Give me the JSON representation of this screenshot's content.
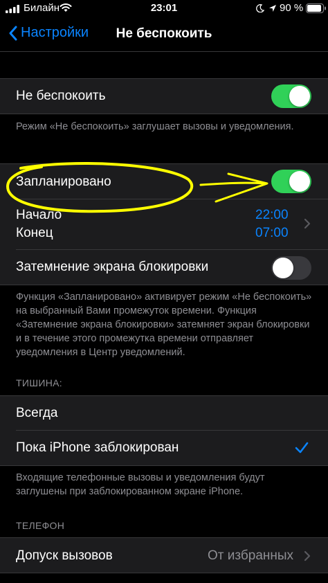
{
  "status": {
    "carrier": "Билайн",
    "time": "23:01",
    "battery": "90 %"
  },
  "nav": {
    "back_label": "Настройки",
    "title": "Не беспокоить"
  },
  "dnd": {
    "label": "Не беспокоить",
    "enabled": true,
    "footer": "Режим «Не беспокоить» заглушает вызовы и уведомления."
  },
  "schedule": {
    "label": "Запланировано",
    "enabled": true,
    "start_label": "Начало",
    "start_value": "22:00",
    "end_label": "Конец",
    "end_value": "07:00",
    "dim_label": "Затемнение экрана блокировки",
    "dim_enabled": false,
    "footer": "Функция «Запланировано» активирует режим «Не беспокоить» на выбранный Вами промежуток времени. Функция «Затемнение экрана блокировки» затемняет экран блокировки и в течение этого промежутка времени отправляет уведомления в Центр уведомлений."
  },
  "silence": {
    "header": "ТИШИНА:",
    "options": [
      "Всегда",
      "Пока iPhone заблокирован"
    ],
    "selected_index": 1,
    "footer": "Входящие телефонные вызовы и уведомления будут заглушены при заблокированном экране iPhone."
  },
  "phone": {
    "header": "ТЕЛЕФОН",
    "allow_calls_label": "Допуск вызовов",
    "allow_calls_value": "От избранных"
  },
  "colors": {
    "accent": "#0a84ff",
    "toggle_on": "#30d158",
    "annotation": "#ffff00"
  }
}
